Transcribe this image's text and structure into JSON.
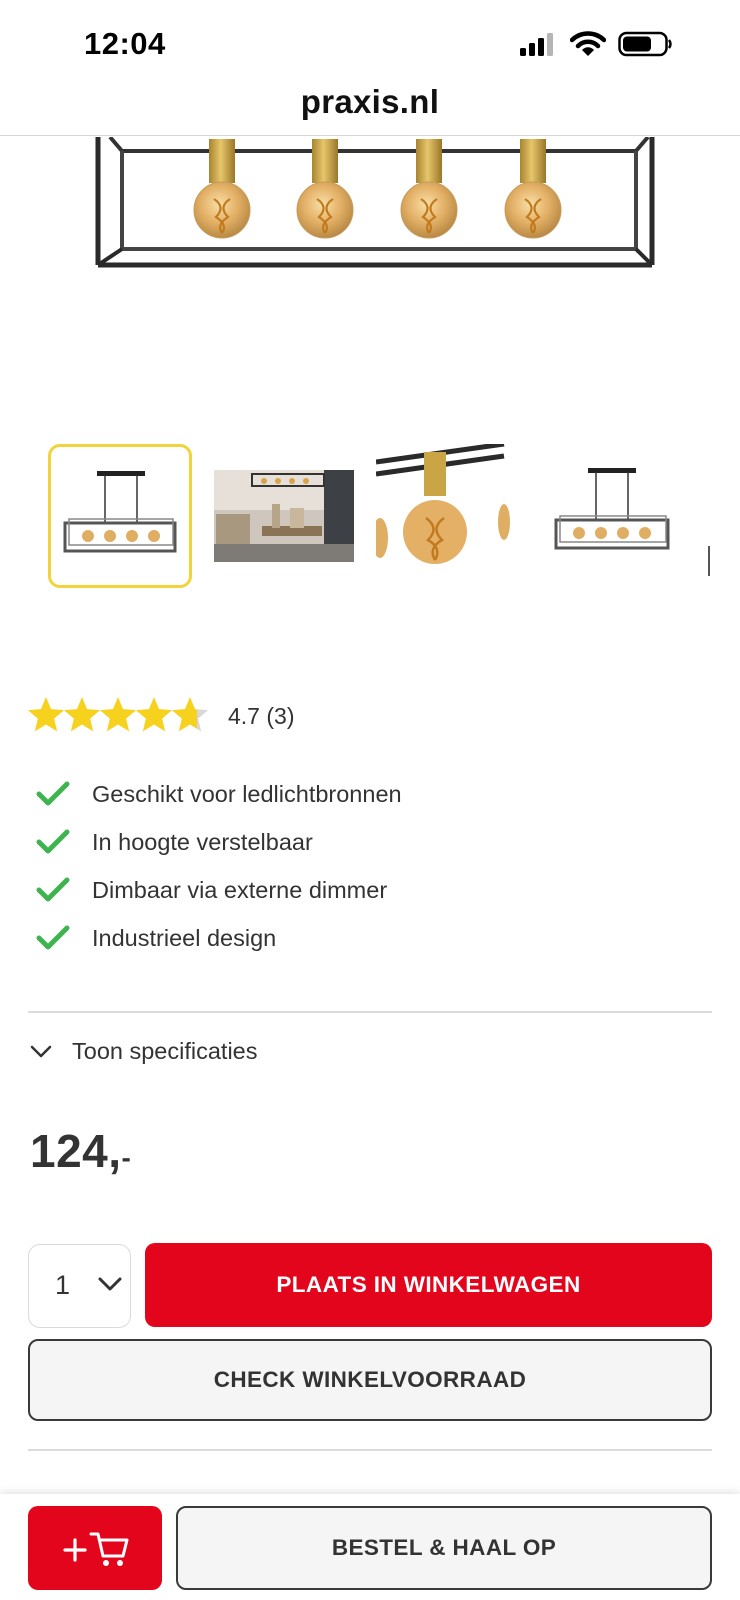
{
  "status_bar": {
    "time": "12:04",
    "icons": [
      "signal-icon",
      "wifi-icon",
      "battery-icon"
    ]
  },
  "browser": {
    "url": "praxis.nl"
  },
  "product": {
    "rating": {
      "stars": 4.7,
      "max_stars": 5,
      "label": "4.7 (3)",
      "star_color": "#f6d21e"
    },
    "usps": [
      {
        "label": "Geschikt voor ledlichtbronnen",
        "icon": "check-icon"
      },
      {
        "label": "In hoogte verstelbaar",
        "icon": "check-icon"
      },
      {
        "label": "Dimbaar via externe dimmer",
        "icon": "check-icon"
      },
      {
        "label": "Industrieel design",
        "icon": "check-icon"
      }
    ],
    "specs_toggle": "Toon specificaties",
    "price": {
      "whole": "124,",
      "cents": "-"
    },
    "quantity": "1"
  },
  "buttons": {
    "add_to_cart": "PLAATS IN WINKELWAGEN",
    "check_stock": "CHECK WINKELVOORRAAD",
    "order_pickup": "BESTEL & HAAL OP"
  },
  "colors": {
    "brand_red": "#e3051b",
    "check_green": "#3fb34f",
    "active_thumb_border": "#f2d33a"
  }
}
